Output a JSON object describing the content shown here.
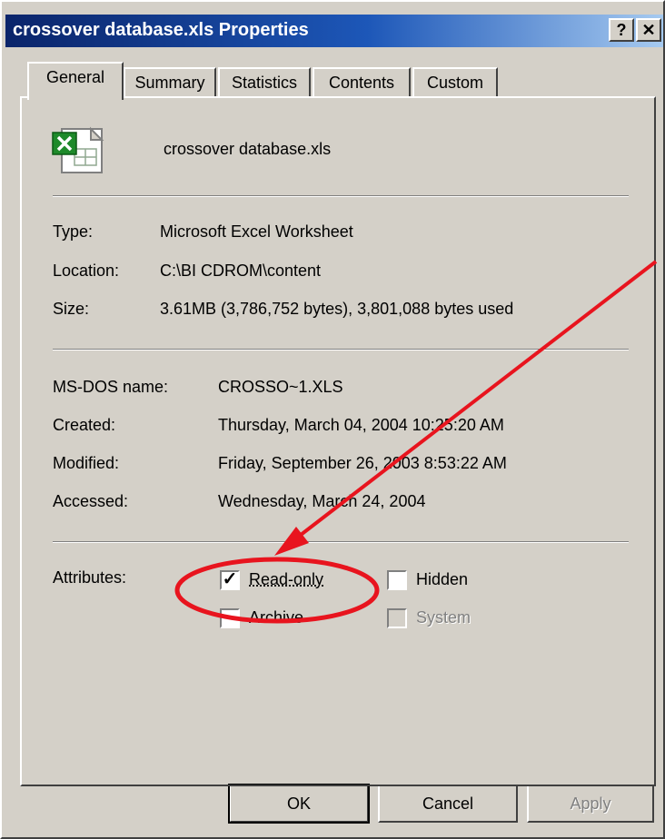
{
  "window": {
    "title": "crossover database.xls Properties",
    "help_button": "?",
    "close_button": "✕"
  },
  "tabs": [
    {
      "label": "General",
      "active": true
    },
    {
      "label": "Summary"
    },
    {
      "label": "Statistics"
    },
    {
      "label": "Contents"
    },
    {
      "label": "Custom"
    }
  ],
  "file": {
    "name": "crossover database.xls",
    "icon": "excel-file-icon"
  },
  "info": {
    "type_label": "Type:",
    "type_value": "Microsoft Excel Worksheet",
    "location_label": "Location:",
    "location_value": "C:\\BI CDROM\\content",
    "size_label": "Size:",
    "size_value": "3.61MB (3,786,752 bytes), 3,801,088 bytes used"
  },
  "dates": {
    "msdos_label": "MS-DOS name:",
    "msdos_value": "CROSSO~1.XLS",
    "created_label": "Created:",
    "created_value": "Thursday, March 04, 2004 10:25:20 AM",
    "modified_label": "Modified:",
    "modified_value": "Friday, September 26, 2003 8:53:22 AM",
    "accessed_label": "Accessed:",
    "accessed_value": "Wednesday, March 24, 2004"
  },
  "attributes": {
    "label": "Attributes:",
    "readonly": {
      "label": "Read-only",
      "checked": true
    },
    "hidden": {
      "label": "Hidden",
      "checked": false
    },
    "archive": {
      "label": "Archive",
      "checked": false
    },
    "system": {
      "label": "System",
      "checked": false,
      "disabled": true
    }
  },
  "buttons": {
    "ok": "OK",
    "cancel": "Cancel",
    "apply": "Apply"
  },
  "colors": {
    "titlebar_start": "#0a246a",
    "titlebar_end": "#a6caf0",
    "face": "#d4d0c8",
    "annotation": "#e8141e"
  }
}
